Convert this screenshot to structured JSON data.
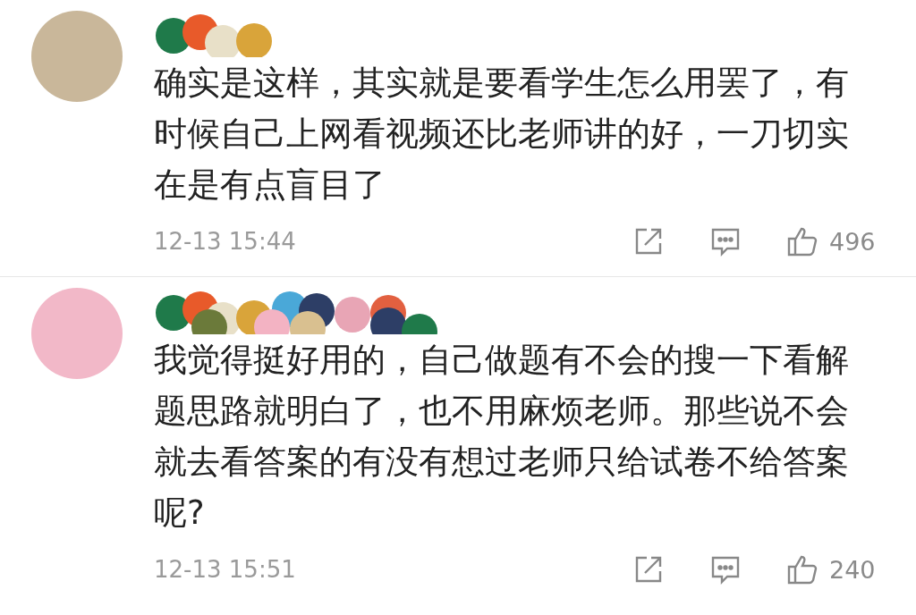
{
  "comments": [
    {
      "text": "确实是这样，其实就是要看学生怎么用罢了，有时候自己上网看视频还比老师讲的好，一刀切实在是有点盲目了",
      "time": "12-13 15:44",
      "likes": "496"
    },
    {
      "text": "我觉得挺好用的，自己做题有不会的搜一下看解题思路就明白了，也不用麻烦老师。那些说不会就去看答案的有没有想过老师只给试卷不给答案呢?",
      "time": "12-13 15:51",
      "likes": "240"
    }
  ]
}
